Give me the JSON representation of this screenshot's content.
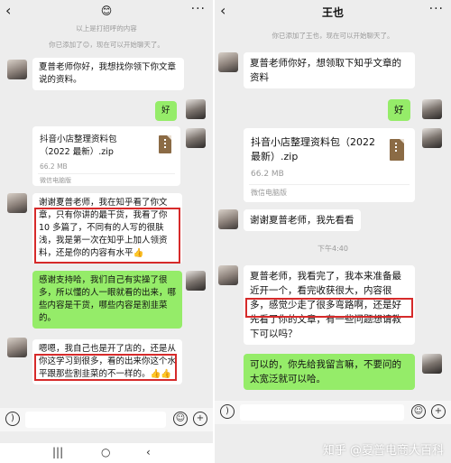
{
  "left": {
    "top_emoji": "😊",
    "sys_read": "以上是打招呼的内容",
    "sys_added": "你已添加了😊，现在可以开始聊天了。",
    "msg1": "夏普老师你好，我想找你领下你文章说的资料。",
    "reply1": "好",
    "file": {
      "name": "抖音小店整理资料包（2022 最新）.zip",
      "size": "66.2 MB",
      "source": "微信电脑版"
    },
    "msg2": "谢谢夏普老师，我在知乎看了你文章，只有你讲的最干货，我看了你10 多篇了，不同有的人写的很肤浅，我是第一次在知乎上加人领资料，还是你的内容有水平👍",
    "reply2": "感谢支持哈，我们自己有实操了很多，所以懂的人一眼就看的出来，哪些内容是干货，哪些内容是割韭菜的。",
    "msg3": "嗯嗯，我自己也是开了店的，还是从你这学习到很多，看的出来你这个水平跟那些割韭菜的不一样的。👍👍",
    "nav": [
      "|||",
      "○",
      "‹"
    ]
  },
  "right": {
    "title": "王也",
    "sys_added": "你已添加了王也，现在可以开始聊天了。",
    "msg1": "夏普老师你好，想领取下知乎文章的资料",
    "reply1": "好",
    "file": {
      "name": "抖音小店整理资料包（2022 最新）.zip",
      "size": "66.2 MB",
      "source": "微信电脑版"
    },
    "msg2": "谢谢夏普老师，我先看看",
    "time": "下午4:40",
    "msg3": "夏普老师，我看完了，我本来准备最近开一个，看完收获很大，内容很多，感觉少走了很多弯路啊，还是好先看了你的文章，有一些问题想请教下可以吗？",
    "reply2": "可以的，你先给我留言嘛，不要问的太宽泛就可以哈。"
  },
  "watermark": "知乎 @夏普电商大百科"
}
